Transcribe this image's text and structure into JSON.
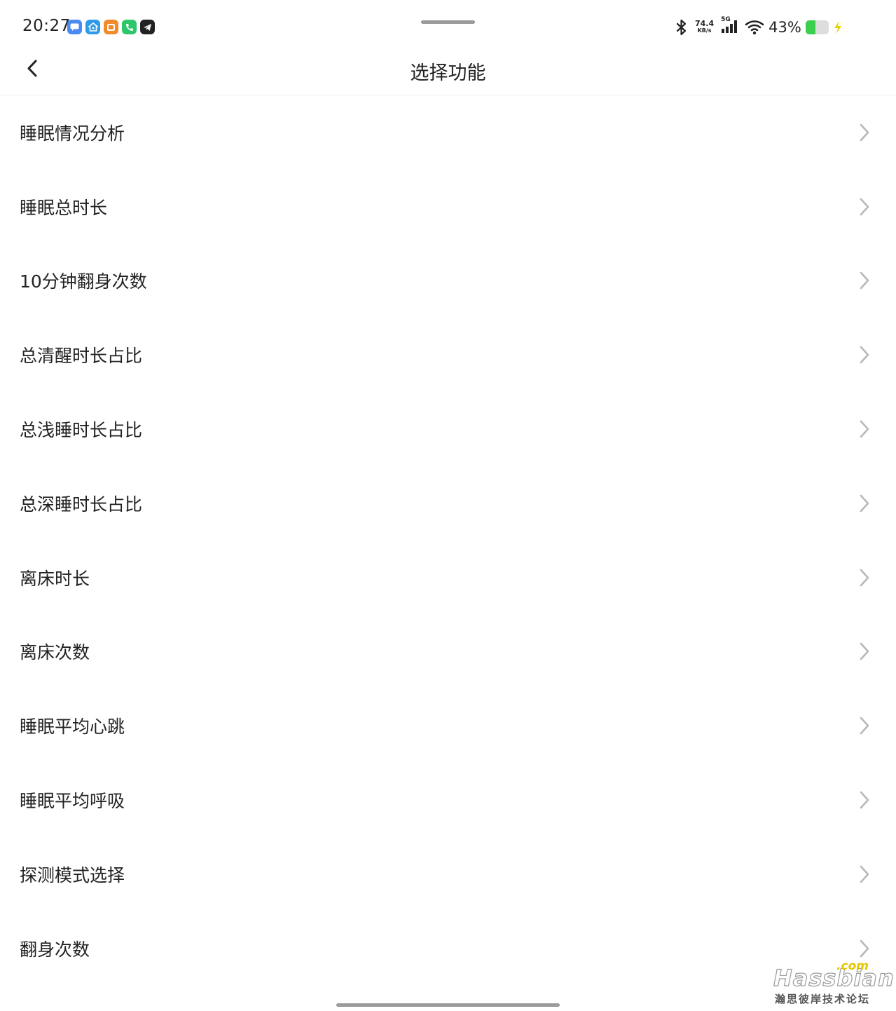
{
  "status_bar": {
    "time": "20:27",
    "notification_icons": [
      {
        "name": "message-app-icon",
        "color": "#4a8af4"
      },
      {
        "name": "smart-home-app-icon",
        "color": "#2f9be8"
      },
      {
        "name": "gallery-app-icon",
        "color": "#f08a2a"
      },
      {
        "name": "phone-app-icon",
        "color": "#2cc76a"
      },
      {
        "name": "telegram-app-icon",
        "color": "#222222"
      }
    ],
    "net_speed_value": "74.4",
    "net_speed_unit": "KB/s",
    "cell_type": "5G",
    "battery_percent": "43%",
    "battery_level": 0.43,
    "battery_color": "#3ccf4e",
    "charging_color": "#e5d400"
  },
  "nav": {
    "title": "选择功能"
  },
  "functions": [
    {
      "label": "睡眠情况分析"
    },
    {
      "label": "睡眠总时长"
    },
    {
      "label": "10分钟翻身次数"
    },
    {
      "label": "总清醒时长占比"
    },
    {
      "label": "总浅睡时长占比"
    },
    {
      "label": "总深睡时长占比"
    },
    {
      "label": "离床时长"
    },
    {
      "label": "离床次数"
    },
    {
      "label": "睡眠平均心跳"
    },
    {
      "label": "睡眠平均呼吸"
    },
    {
      "label": "探测模式选择"
    },
    {
      "label": "翻身次数"
    }
  ],
  "watermark": {
    "brand": "Hassbian",
    "suffix": ".com",
    "subtitle": "瀚思彼岸技术论坛"
  }
}
